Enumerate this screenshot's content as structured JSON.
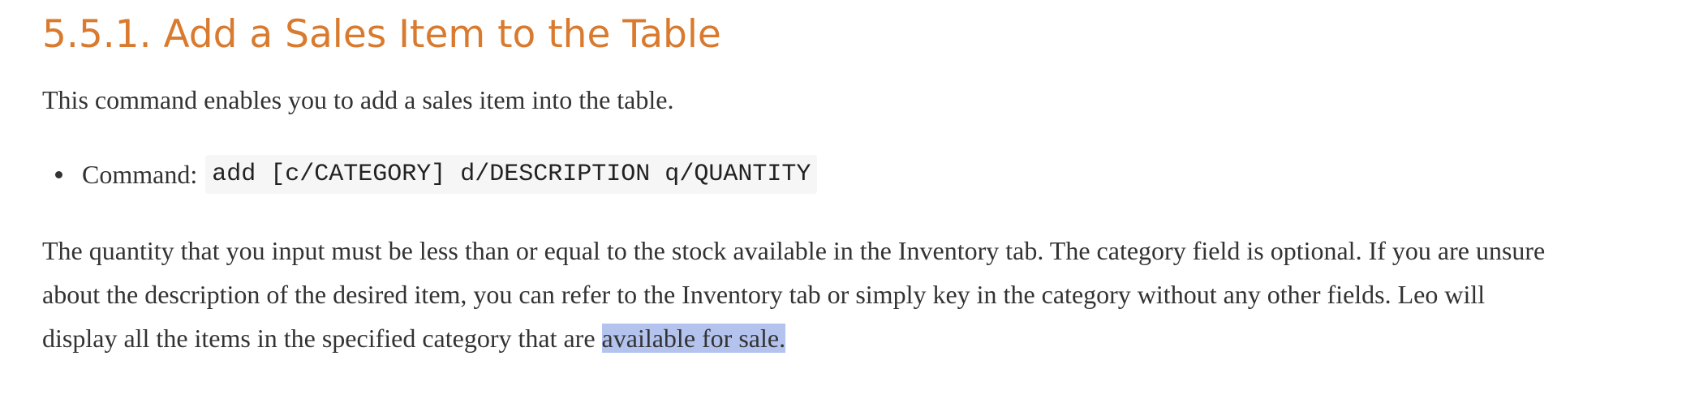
{
  "section": {
    "heading": "5.5.1. Add a Sales Item to the Table",
    "intro": "This command enables you to add a sales item into the table.",
    "command_label": "Command:",
    "command_syntax": "add [c/CATEGORY] d/DESCRIPTION q/QUANTITY",
    "paragraph_lines": [
      "The quantity that you input must be less than or equal to the stock available in the Inventory tab. The category field is optional. If you are unsure",
      "about the description of the desired item, you can refer to the Inventory tab or simply key in the category without any other fields. Leo will",
      "display all the items in the specified category that are "
    ],
    "highlighted_text": "available for sale",
    "after_highlight": "."
  },
  "colors": {
    "heading": "#d97a2e",
    "body_text": "#333333",
    "code_background": "#f6f6f6",
    "selection_highlight": "#b4c3ee"
  }
}
